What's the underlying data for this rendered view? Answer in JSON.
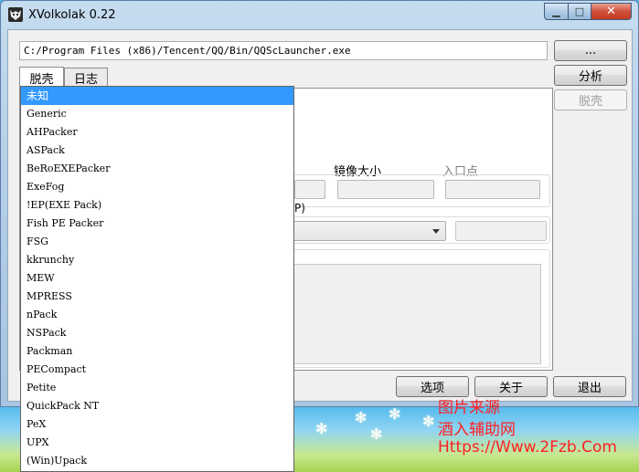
{
  "window": {
    "title": "XVolkolak 0.22",
    "minimize_glyph": "▁",
    "maximize_glyph": "□",
    "close_glyph": "✕"
  },
  "path": {
    "value": "C:/Program Files (x86)/Tencent/QQ/Bin/QQScLauncher.exe"
  },
  "buttons": {
    "browse": "...",
    "analyze": "分析",
    "unpack": "脱壳",
    "options": "选项",
    "about": "关于",
    "exit": "退出"
  },
  "tabs": [
    {
      "label": "脱壳"
    },
    {
      "label": "日志"
    }
  ],
  "fields": {
    "image_size_label": "镜像大小",
    "entry_point_label": "入口点",
    "partial_label_suffix": "P)"
  },
  "dropdown": {
    "items": [
      "未知",
      "Generic",
      "AHPacker",
      "ASPack",
      "BeRoEXEPacker",
      "ExeFog",
      "!EP(EXE Pack)",
      "Fish PE Packer",
      "FSG",
      "kkrunchy",
      "MEW",
      "MPRESS",
      "nPack",
      "NSPack",
      "Packman",
      "PECompact",
      "Petite",
      "QuickPack NT",
      "PeX",
      "UPX",
      "(Win)Upack"
    ],
    "selected_index": 0
  },
  "watermark": {
    "line1": "图片来源",
    "line2": "酒入辅助网",
    "line3": "Https://Www.2Fzb.Com"
  },
  "colors": {
    "selection": "#3399ff",
    "watermark": "#ff2020",
    "close_button": "#c23a22"
  }
}
